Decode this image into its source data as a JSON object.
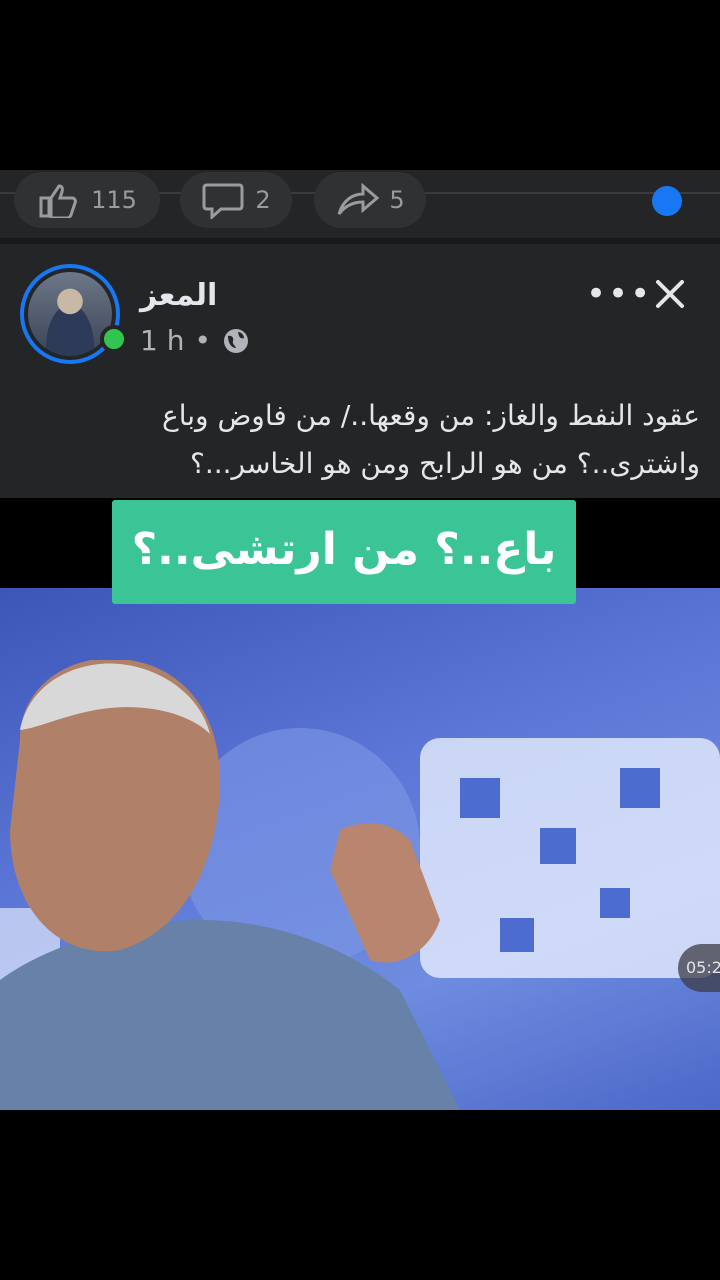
{
  "previous_post": {
    "like_count": "115",
    "comment_count": "2",
    "share_count": "5"
  },
  "post": {
    "author": "المعز",
    "time": "1 h",
    "dot": "•",
    "more_label": "•••",
    "caption": "عقود النفط والغاز: من وقعها../ من فاوض وباع واشترى..؟ من هو الرابح ومن هو الخاسر...؟"
  },
  "video": {
    "banner_text": "باع..؟ من ارتشى..؟",
    "timestamp": "05:2"
  },
  "colors": {
    "accent": "#1877f2",
    "online": "#31c451",
    "banner": "#3bc597",
    "panel": "#242526"
  }
}
